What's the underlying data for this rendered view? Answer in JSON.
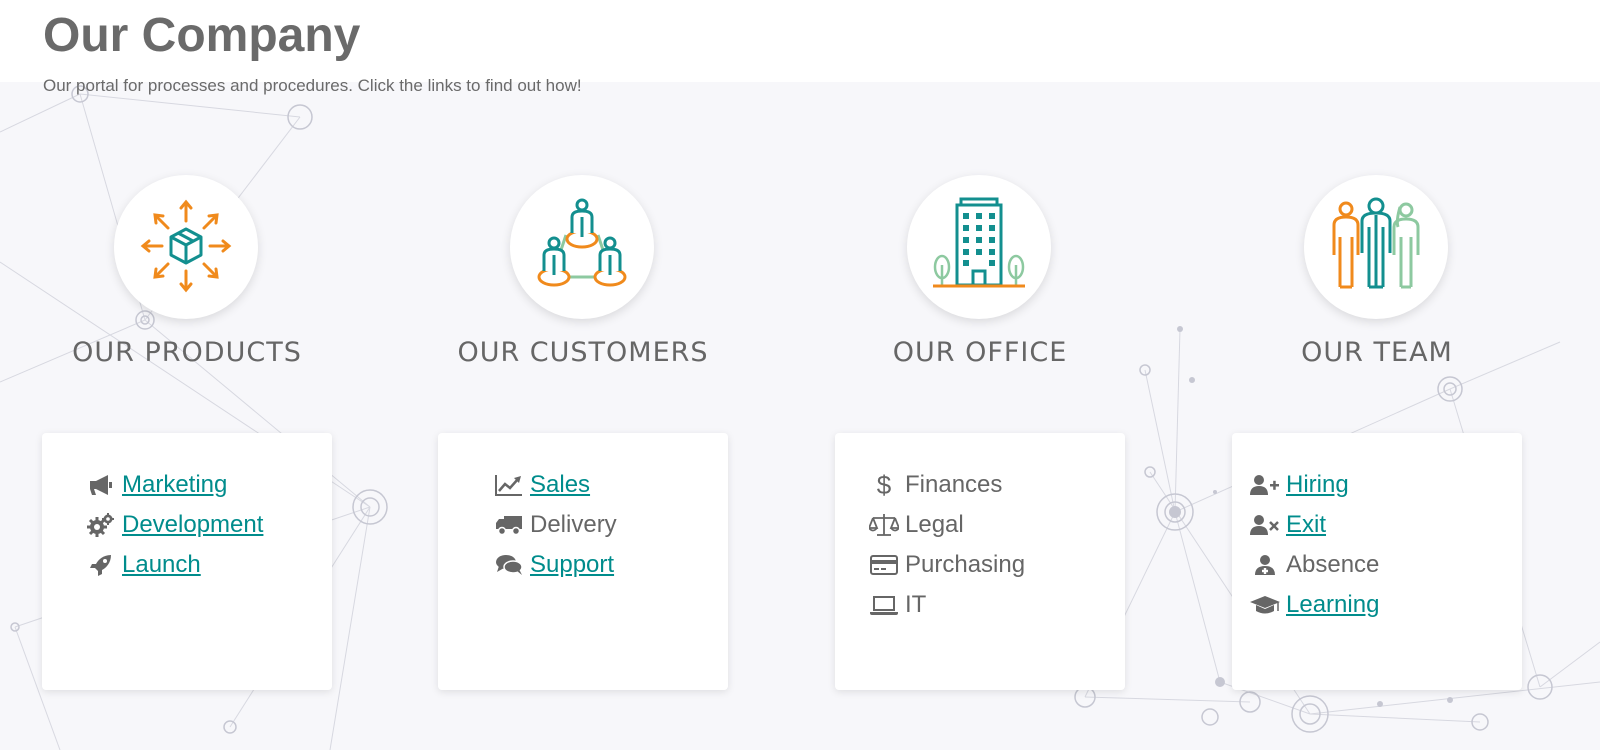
{
  "header": {
    "title": "Our Company",
    "subtitle": "Our portal for processes and procedures. Click the links to find out how!"
  },
  "colors": {
    "link": "#008c8c",
    "teal": "#138f8f",
    "orange": "#f08a1c",
    "green": "#8dc9a0",
    "text": "#666666"
  },
  "sections": [
    {
      "icon": "product-distribution-icon",
      "heading": "OUR PRODUCTS",
      "items": [
        {
          "icon": "megaphone-icon",
          "label": "Marketing",
          "link": true
        },
        {
          "icon": "gears-icon",
          "label": "Development",
          "link": true
        },
        {
          "icon": "rocket-icon",
          "label": "Launch",
          "link": true
        }
      ]
    },
    {
      "icon": "customer-network-icon",
      "heading": "OUR CUSTOMERS",
      "items": [
        {
          "icon": "chart-line-icon",
          "label": "Sales",
          "link": true
        },
        {
          "icon": "truck-icon",
          "label": "Delivery",
          "link": false
        },
        {
          "icon": "chat-bubbles-icon",
          "label": "Support",
          "link": true
        }
      ]
    },
    {
      "icon": "office-building-icon",
      "heading": "OUR OFFICE",
      "items": [
        {
          "icon": "dollar-icon",
          "label": "Finances",
          "link": false
        },
        {
          "icon": "scale-icon",
          "label": "Legal",
          "link": false
        },
        {
          "icon": "credit-card-icon",
          "label": "Purchasing",
          "link": false
        },
        {
          "icon": "laptop-icon",
          "label": "IT",
          "link": false
        }
      ]
    },
    {
      "icon": "team-people-icon",
      "heading": "OUR TEAM",
      "items": [
        {
          "icon": "user-plus-icon",
          "label": "Hiring",
          "link": true
        },
        {
          "icon": "user-times-icon",
          "label": "Exit",
          "link": true
        },
        {
          "icon": "user-doctor-icon",
          "label": "Absence",
          "link": false
        },
        {
          "icon": "graduation-cap-icon",
          "label": "Learning",
          "link": true
        }
      ]
    }
  ]
}
